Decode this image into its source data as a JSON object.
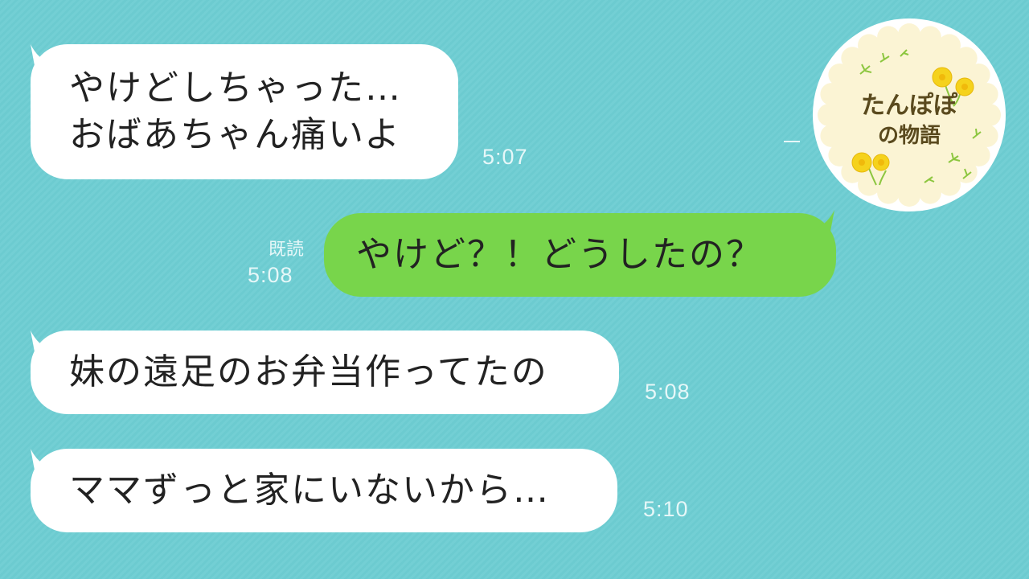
{
  "messages": [
    {
      "direction": "incoming",
      "text": "やけどしちゃった…\nおばあちゃん痛いよ",
      "time": "5:07"
    },
    {
      "direction": "outgoing",
      "text": "やけど？！どうしたの？",
      "time": "5:08",
      "read": "既読"
    },
    {
      "direction": "incoming",
      "text": "妹の遠足のお弁当作ってたの",
      "time": "5:08"
    },
    {
      "direction": "incoming",
      "text": "ママずっと家にいないから…",
      "time": "5:10"
    }
  ],
  "badge": {
    "title": "たんぽぽ",
    "subtitle": "の物語"
  },
  "colors": {
    "background": "#6ccbd0",
    "incoming_bubble": "#ffffff",
    "outgoing_bubble": "#78d54b",
    "badge_fill": "#fbf4d4",
    "flower": "#f5d21c"
  }
}
